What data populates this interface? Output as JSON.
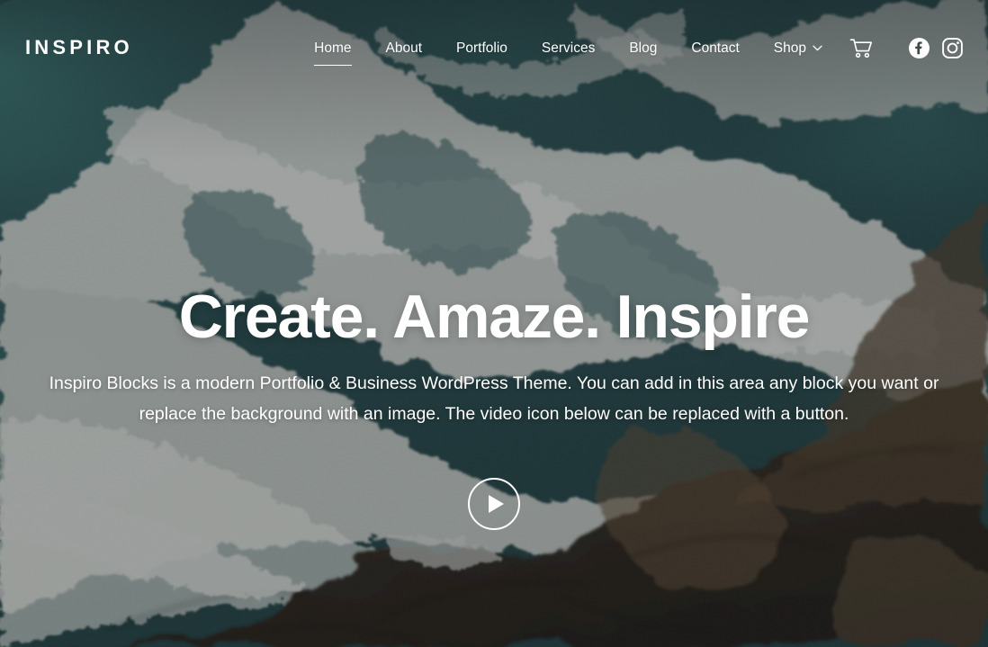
{
  "site": {
    "brand": "INSPIRO"
  },
  "nav": {
    "items": [
      {
        "label": "Home",
        "active": true,
        "has_submenu": false
      },
      {
        "label": "About",
        "active": false,
        "has_submenu": false
      },
      {
        "label": "Portfolio",
        "active": false,
        "has_submenu": false
      },
      {
        "label": "Services",
        "active": false,
        "has_submenu": false
      },
      {
        "label": "Blog",
        "active": false,
        "has_submenu": false
      },
      {
        "label": "Contact",
        "active": false,
        "has_submenu": false
      },
      {
        "label": "Shop",
        "active": false,
        "has_submenu": true
      }
    ],
    "icons": {
      "cart": "shopping-cart-icon",
      "facebook": "facebook-icon",
      "instagram": "instagram-icon",
      "chevron": "chevron-down-icon"
    }
  },
  "hero": {
    "title": "Create. Amaze. Inspire",
    "subtitle_line1": "Inspiro Blocks is a modern Portfolio & Business WordPress Theme. You can add in this area any block you want or",
    "subtitle_line2": "replace the background with an image. The video icon below can be replaced with a button.",
    "play_button": "play-button"
  },
  "colors": {
    "text": "#ffffff",
    "ocean_deep": "#234a4e",
    "ocean_mid": "#2f6065",
    "ocean_teal": "#3f7d7c",
    "foam": "#cfd3d0",
    "rock_dark": "#24201d",
    "rock_brown": "#5a4a38",
    "overlay": "rgba(22,26,28,0.30)"
  }
}
